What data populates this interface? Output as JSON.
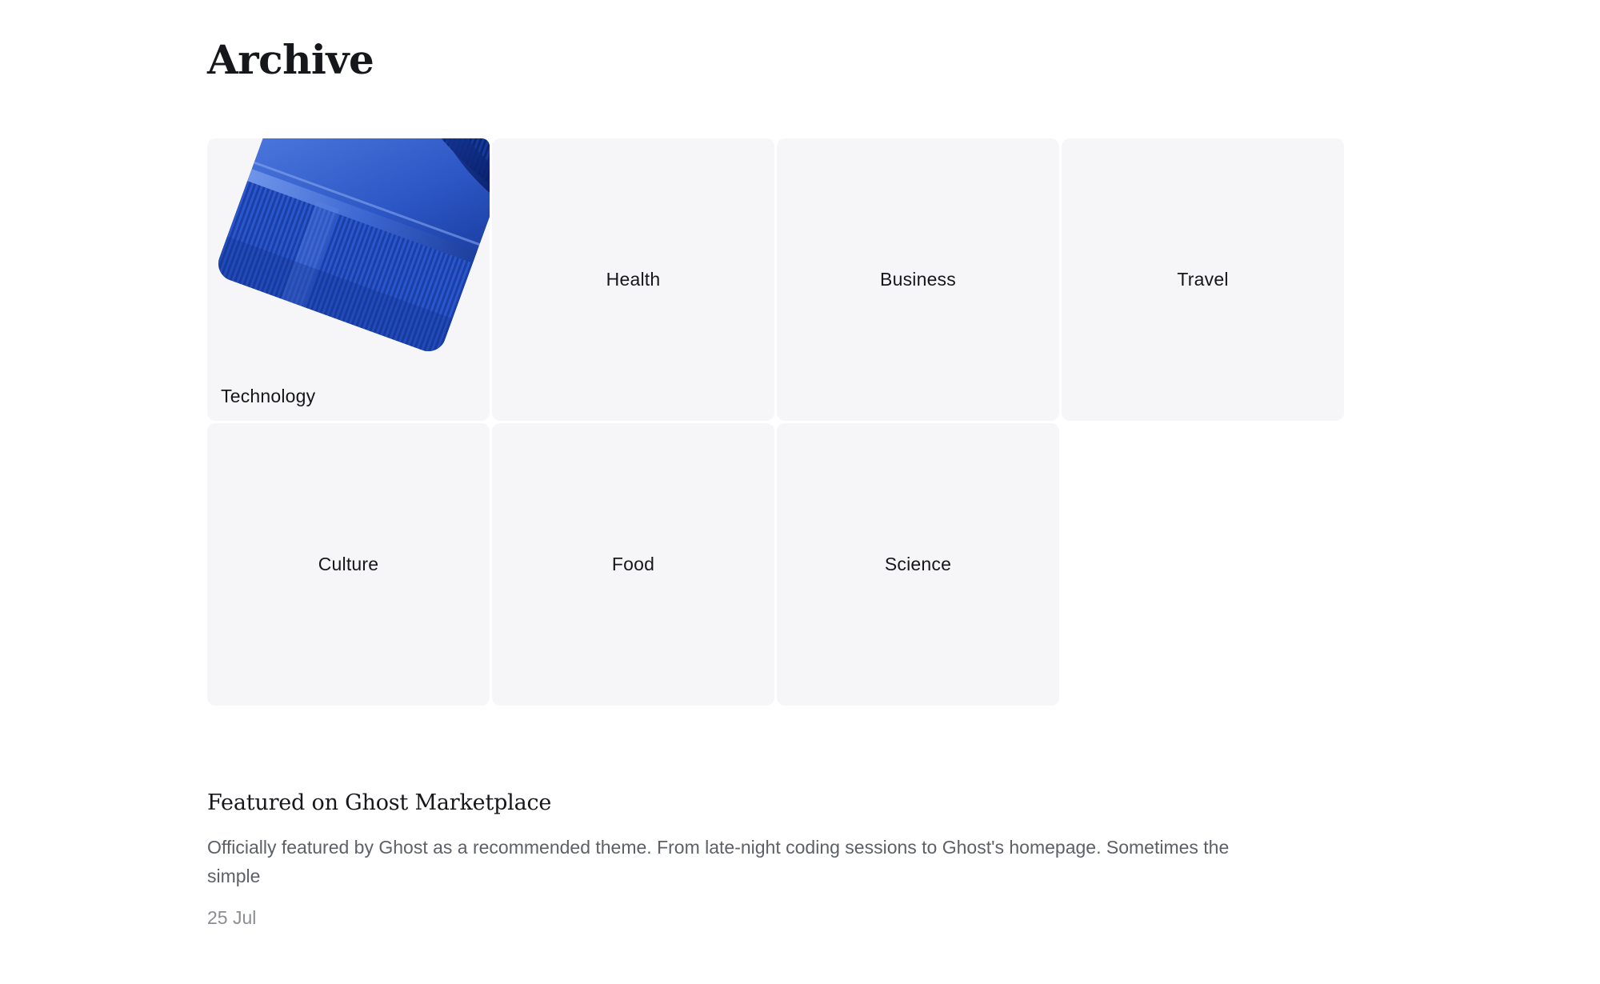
{
  "page": {
    "title": "Archive"
  },
  "tags": [
    {
      "name": "Technology",
      "has_image": true
    },
    {
      "name": "Health",
      "has_image": false
    },
    {
      "name": "Business",
      "has_image": false
    },
    {
      "name": "Travel",
      "has_image": false
    },
    {
      "name": "Culture",
      "has_image": false
    },
    {
      "name": "Food",
      "has_image": false
    },
    {
      "name": "Science",
      "has_image": false
    }
  ],
  "featured_post": {
    "title": "Featured on Ghost Marketplace",
    "excerpt": "Officially featured by Ghost as a recommended theme. From late-night coding sessions to Ghost's homepage. Sometimes the simple",
    "date": "25 Jul"
  },
  "colors": {
    "card_background": "#f6f6f8",
    "text_primary": "#15171a",
    "text_secondary": "#5d6066",
    "text_muted": "#8a8d92",
    "image_blue": "#2f5fd0"
  }
}
